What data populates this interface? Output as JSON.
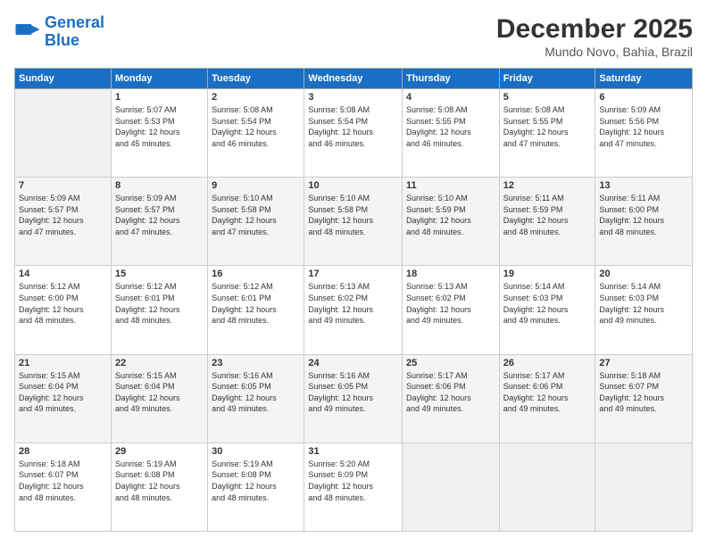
{
  "header": {
    "logo_line1": "General",
    "logo_line2": "Blue",
    "month": "December 2025",
    "location": "Mundo Novo, Bahia, Brazil"
  },
  "weekdays": [
    "Sunday",
    "Monday",
    "Tuesday",
    "Wednesday",
    "Thursday",
    "Friday",
    "Saturday"
  ],
  "weeks": [
    [
      {
        "day": "",
        "info": ""
      },
      {
        "day": "1",
        "info": "Sunrise: 5:07 AM\nSunset: 5:53 PM\nDaylight: 12 hours\nand 45 minutes."
      },
      {
        "day": "2",
        "info": "Sunrise: 5:08 AM\nSunset: 5:54 PM\nDaylight: 12 hours\nand 46 minutes."
      },
      {
        "day": "3",
        "info": "Sunrise: 5:08 AM\nSunset: 5:54 PM\nDaylight: 12 hours\nand 46 minutes."
      },
      {
        "day": "4",
        "info": "Sunrise: 5:08 AM\nSunset: 5:55 PM\nDaylight: 12 hours\nand 46 minutes."
      },
      {
        "day": "5",
        "info": "Sunrise: 5:08 AM\nSunset: 5:55 PM\nDaylight: 12 hours\nand 47 minutes."
      },
      {
        "day": "6",
        "info": "Sunrise: 5:09 AM\nSunset: 5:56 PM\nDaylight: 12 hours\nand 47 minutes."
      }
    ],
    [
      {
        "day": "7",
        "info": "Sunrise: 5:09 AM\nSunset: 5:57 PM\nDaylight: 12 hours\nand 47 minutes."
      },
      {
        "day": "8",
        "info": "Sunrise: 5:09 AM\nSunset: 5:57 PM\nDaylight: 12 hours\nand 47 minutes."
      },
      {
        "day": "9",
        "info": "Sunrise: 5:10 AM\nSunset: 5:58 PM\nDaylight: 12 hours\nand 47 minutes."
      },
      {
        "day": "10",
        "info": "Sunrise: 5:10 AM\nSunset: 5:58 PM\nDaylight: 12 hours\nand 48 minutes."
      },
      {
        "day": "11",
        "info": "Sunrise: 5:10 AM\nSunset: 5:59 PM\nDaylight: 12 hours\nand 48 minutes."
      },
      {
        "day": "12",
        "info": "Sunrise: 5:11 AM\nSunset: 5:59 PM\nDaylight: 12 hours\nand 48 minutes."
      },
      {
        "day": "13",
        "info": "Sunrise: 5:11 AM\nSunset: 6:00 PM\nDaylight: 12 hours\nand 48 minutes."
      }
    ],
    [
      {
        "day": "14",
        "info": "Sunrise: 5:12 AM\nSunset: 6:00 PM\nDaylight: 12 hours\nand 48 minutes."
      },
      {
        "day": "15",
        "info": "Sunrise: 5:12 AM\nSunset: 6:01 PM\nDaylight: 12 hours\nand 48 minutes."
      },
      {
        "day": "16",
        "info": "Sunrise: 5:12 AM\nSunset: 6:01 PM\nDaylight: 12 hours\nand 48 minutes."
      },
      {
        "day": "17",
        "info": "Sunrise: 5:13 AM\nSunset: 6:02 PM\nDaylight: 12 hours\nand 49 minutes."
      },
      {
        "day": "18",
        "info": "Sunrise: 5:13 AM\nSunset: 6:02 PM\nDaylight: 12 hours\nand 49 minutes."
      },
      {
        "day": "19",
        "info": "Sunrise: 5:14 AM\nSunset: 6:03 PM\nDaylight: 12 hours\nand 49 minutes."
      },
      {
        "day": "20",
        "info": "Sunrise: 5:14 AM\nSunset: 6:03 PM\nDaylight: 12 hours\nand 49 minutes."
      }
    ],
    [
      {
        "day": "21",
        "info": "Sunrise: 5:15 AM\nSunset: 6:04 PM\nDaylight: 12 hours\nand 49 minutes."
      },
      {
        "day": "22",
        "info": "Sunrise: 5:15 AM\nSunset: 6:04 PM\nDaylight: 12 hours\nand 49 minutes."
      },
      {
        "day": "23",
        "info": "Sunrise: 5:16 AM\nSunset: 6:05 PM\nDaylight: 12 hours\nand 49 minutes."
      },
      {
        "day": "24",
        "info": "Sunrise: 5:16 AM\nSunset: 6:05 PM\nDaylight: 12 hours\nand 49 minutes."
      },
      {
        "day": "25",
        "info": "Sunrise: 5:17 AM\nSunset: 6:06 PM\nDaylight: 12 hours\nand 49 minutes."
      },
      {
        "day": "26",
        "info": "Sunrise: 5:17 AM\nSunset: 6:06 PM\nDaylight: 12 hours\nand 49 minutes."
      },
      {
        "day": "27",
        "info": "Sunrise: 5:18 AM\nSunset: 6:07 PM\nDaylight: 12 hours\nand 49 minutes."
      }
    ],
    [
      {
        "day": "28",
        "info": "Sunrise: 5:18 AM\nSunset: 6:07 PM\nDaylight: 12 hours\nand 48 minutes."
      },
      {
        "day": "29",
        "info": "Sunrise: 5:19 AM\nSunset: 6:08 PM\nDaylight: 12 hours\nand 48 minutes."
      },
      {
        "day": "30",
        "info": "Sunrise: 5:19 AM\nSunset: 6:08 PM\nDaylight: 12 hours\nand 48 minutes."
      },
      {
        "day": "31",
        "info": "Sunrise: 5:20 AM\nSunset: 6:09 PM\nDaylight: 12 hours\nand 48 minutes."
      },
      {
        "day": "",
        "info": ""
      },
      {
        "day": "",
        "info": ""
      },
      {
        "day": "",
        "info": ""
      }
    ]
  ]
}
